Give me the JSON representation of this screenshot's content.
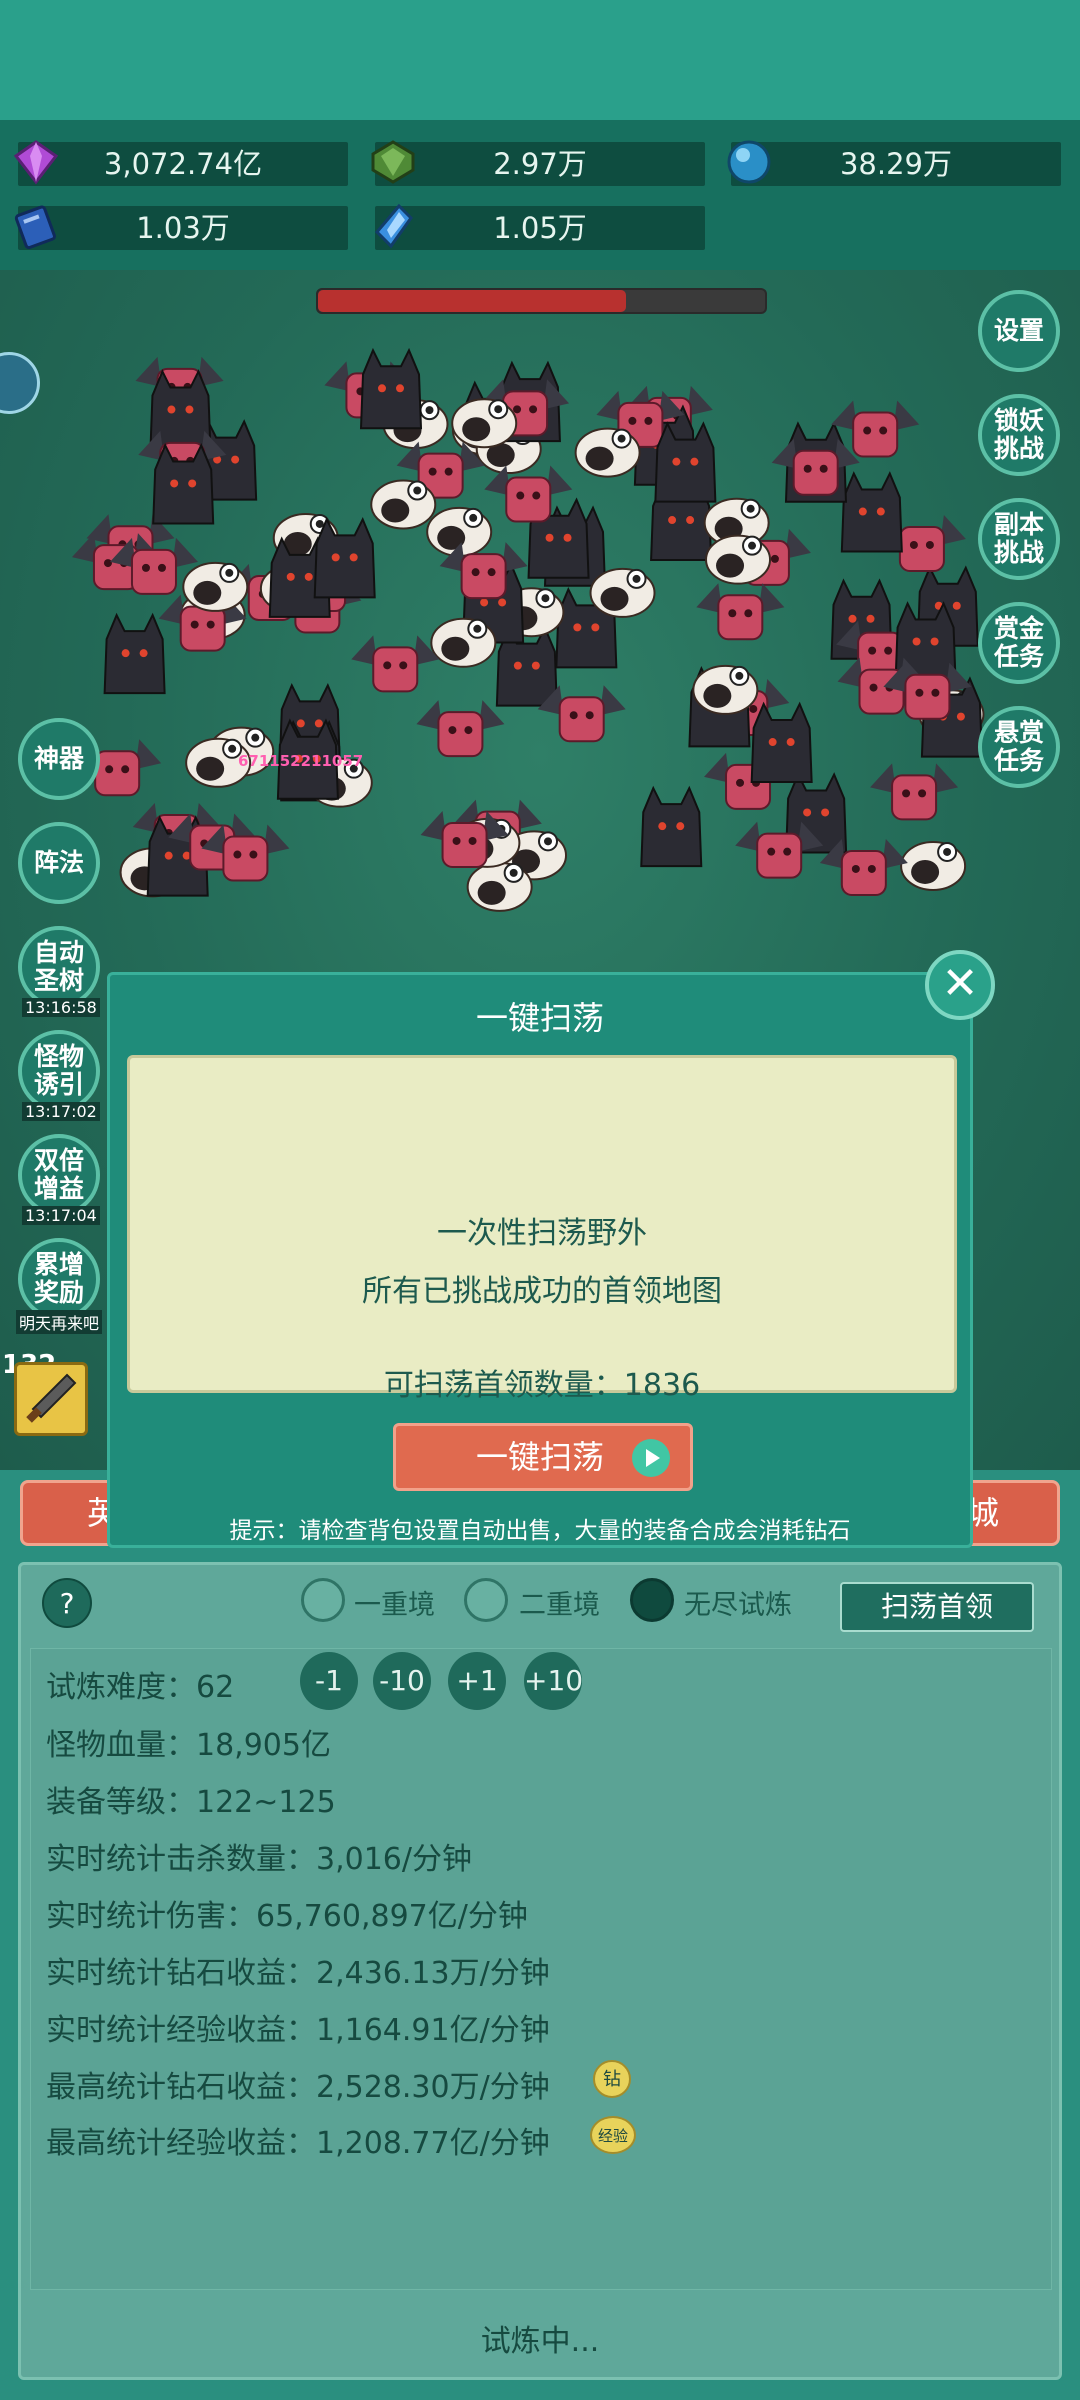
{
  "resources": [
    {
      "name": "purple-gem-icon",
      "value": "3,072.74亿"
    },
    {
      "name": "green-gem-icon",
      "value": "2.97万"
    },
    {
      "name": "blue-orb-icon",
      "value": "38.29万"
    },
    {
      "name": "blue-book-icon",
      "value": "1.03万"
    },
    {
      "name": "blue-crystal-icon",
      "value": "1.05万"
    }
  ],
  "right_menu": [
    "设置",
    "锁妖\n挑战",
    "副本\n挑战",
    "赏金\n任务",
    "悬赏\n任务"
  ],
  "left_menu": [
    {
      "label": "神器",
      "timer": ""
    },
    {
      "label": "阵法",
      "timer": ""
    },
    {
      "label": "自动\n圣树",
      "timer": "13:16:58"
    },
    {
      "label": "怪物\n诱引",
      "timer": "13:17:02"
    },
    {
      "label": "双倍\n增益",
      "timer": "13:17:04"
    },
    {
      "label": "累增\n奖励",
      "timer": "明天再来吧"
    }
  ],
  "damage_text": "671152211057",
  "bottom_tabs": {
    "left": "英",
    "right": "城"
  },
  "level_badge": "132",
  "modes": [
    "一重境",
    "二重境",
    "无尽试炼"
  ],
  "sweep_boss_label": "扫荡首领",
  "help_label": "?",
  "steps": [
    "-1",
    "-10",
    "+1",
    "+10"
  ],
  "stats": {
    "difficulty_label": "试炼难度：",
    "difficulty_value": "62",
    "lines": [
      "怪物血量：18,905亿",
      "装备等级：122~125",
      "实时统计击杀数量：3,016/分钟",
      "实时统计伤害：65,760,897亿/分钟",
      "实时统计钻石收益：2,436.13万/分钟",
      "实时统计经验收益：1,164.91亿/分钟",
      "最高统计钻石收益：2,528.30万/分钟",
      "最高统计经验收益：1,208.77亿/分钟"
    ],
    "badge_diamond": "钻",
    "badge_exp": "经验"
  },
  "status_text": "试炼中...",
  "modal": {
    "title": "一键扫荡",
    "line1": "一次性扫荡野外",
    "line2": "所有已挑战成功的首领地图",
    "count_line": "可扫荡首领数量：1836",
    "button": "一键扫荡",
    "tip": "提示：请检查背包设置自动出售，大量的装备合成会消耗钻石",
    "close": "✕"
  }
}
